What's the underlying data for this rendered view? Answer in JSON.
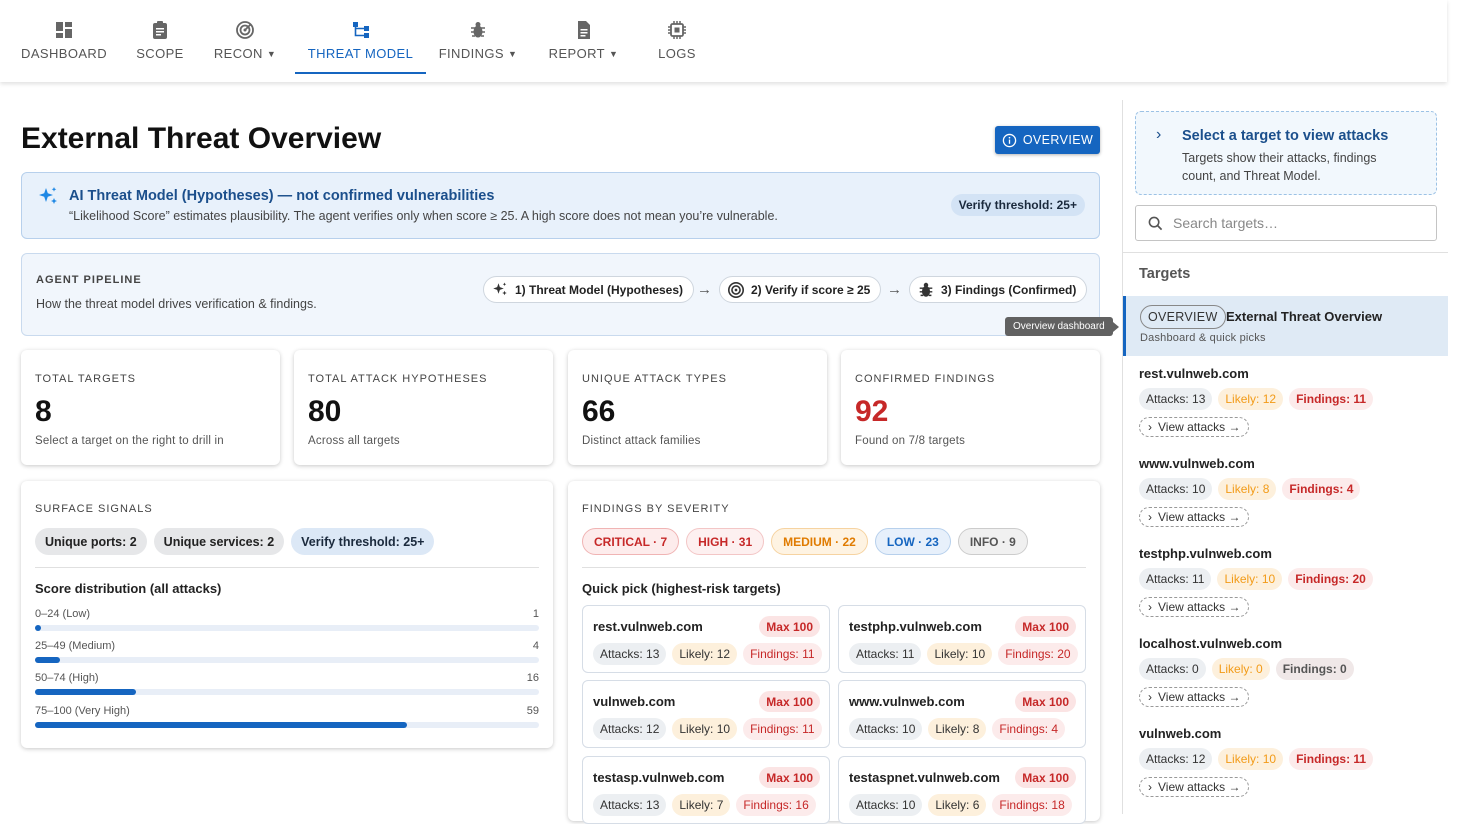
{
  "nav": {
    "items": [
      {
        "label": "DASHBOARD",
        "icon": "dashboard-icon",
        "caret": false
      },
      {
        "label": "SCOPE",
        "icon": "clipboard-icon",
        "caret": false
      },
      {
        "label": "RECON",
        "icon": "target-icon",
        "caret": true
      },
      {
        "label": "THREAT MODEL",
        "icon": "hierarchy-icon",
        "caret": false,
        "active": true
      },
      {
        "label": "FINDINGS",
        "icon": "bug-icon",
        "caret": true
      },
      {
        "label": "REPORT",
        "icon": "document-icon",
        "caret": true
      },
      {
        "label": "LOGS",
        "icon": "chip-icon",
        "caret": false
      }
    ]
  },
  "page": {
    "title": "External Threat Overview",
    "overview_button": "OVERVIEW"
  },
  "ai_notice": {
    "title": "AI Threat Model (Hypotheses) — not confirmed vulnerabilities",
    "text": "“Likelihood Score” estimates plausibility. The agent verifies only when score ≥ 25. A high score does not mean you’re vulnerable.",
    "chip": "Verify threshold: 25+"
  },
  "pipeline": {
    "title": "AGENT PIPELINE",
    "subtitle": "How the threat model drives verification & findings.",
    "steps": [
      "1) Threat Model (Hypotheses)",
      "2) Verify if score ≥ 25",
      "3) Findings (Confirmed)"
    ],
    "arrow": "→",
    "tooltip": "Overview dashboard"
  },
  "stats": [
    {
      "label": "TOTAL TARGETS",
      "value": "8",
      "hint": "Select a target on the right to drill in"
    },
    {
      "label": "TOTAL ATTACK HYPOTHESES",
      "value": "80",
      "hint": "Across all targets"
    },
    {
      "label": "UNIQUE ATTACK TYPES",
      "value": "66",
      "hint": "Distinct attack families"
    },
    {
      "label": "CONFIRMED FINDINGS",
      "value": "92",
      "hint": "Found on 7/8 targets"
    }
  ],
  "surface": {
    "title": "SURFACE SIGNALS",
    "chips": [
      "Unique ports: 2",
      "Unique services: 2",
      "Verify threshold: 25+"
    ],
    "dist_title": "Score distribution (all attacks)",
    "dist_max": 59,
    "dist": [
      {
        "label": "0–24 (Low)",
        "count": 1
      },
      {
        "label": "25–49 (Medium)",
        "count": 4
      },
      {
        "label": "50–74 (High)",
        "count": 16
      },
      {
        "label": "75–100 (Very High)",
        "count": 59
      }
    ]
  },
  "severity": {
    "title": "FINDINGS BY SEVERITY",
    "chips": [
      {
        "label": "CRITICAL · 7",
        "color": "#c62828",
        "bg": "#fdecec",
        "border": "#f0b4b4"
      },
      {
        "label": "HIGH · 31",
        "color": "#c62828",
        "bg": "#fdf0f0",
        "border": "#f3c6c6"
      },
      {
        "label": "MEDIUM · 22",
        "color": "#e07b00",
        "bg": "#fef3e2",
        "border": "#f6d3a1"
      },
      {
        "label": "LOW · 23",
        "color": "#1565c0",
        "bg": "#e7f0fb",
        "border": "#b7d0ec"
      },
      {
        "label": "INFO · 9",
        "color": "#555555",
        "bg": "#f0f0f0",
        "border": "#cccccc"
      }
    ],
    "quick_title": "Quick pick (highest-risk targets)",
    "quick": [
      {
        "name": "rest.vulnweb.com",
        "max": "Max 100",
        "attacks": "Attacks: 13",
        "likely": "Likely: 12",
        "findings": "Findings: 11"
      },
      {
        "name": "testphp.vulnweb.com",
        "max": "Max 100",
        "attacks": "Attacks: 11",
        "likely": "Likely: 10",
        "findings": "Findings: 20"
      },
      {
        "name": "vulnweb.com",
        "max": "Max 100",
        "attacks": "Attacks: 12",
        "likely": "Likely: 10",
        "findings": "Findings: 11"
      },
      {
        "name": "www.vulnweb.com",
        "max": "Max 100",
        "attacks": "Attacks: 10",
        "likely": "Likely: 8",
        "findings": "Findings: 4"
      },
      {
        "name": "testasp.vulnweb.com",
        "max": "Max 100",
        "attacks": "Attacks: 13",
        "likely": "Likely: 7",
        "findings": "Findings: 16"
      },
      {
        "name": "testaspnet.vulnweb.com",
        "max": "Max 100",
        "attacks": "Attacks: 10",
        "likely": "Likely: 6",
        "findings": "Findings: 18"
      }
    ]
  },
  "sidebar": {
    "select_title": "Select a target to view attacks",
    "select_text": "Targets show their attacks, findings count, and Threat Model.",
    "search_placeholder": "Search targets…",
    "targets_title": "Targets",
    "overview_pill": "OVERVIEW",
    "overview_name": "External Threat Overview",
    "overview_sub": "Dashboard & quick picks",
    "view_label": "View attacks →",
    "targets": [
      {
        "name": "rest.vulnweb.com",
        "attacks": "Attacks: 13",
        "likely": "Likely: 12",
        "findings": "Findings: 11",
        "zero": false
      },
      {
        "name": "www.vulnweb.com",
        "attacks": "Attacks: 10",
        "likely": "Likely: 8",
        "findings": "Findings: 4",
        "zero": false
      },
      {
        "name": "testphp.vulnweb.com",
        "attacks": "Attacks: 11",
        "likely": "Likely: 10",
        "findings": "Findings: 20",
        "zero": false
      },
      {
        "name": "localhost.vulnweb.com",
        "attacks": "Attacks: 0",
        "likely": "Likely: 0",
        "findings": "Findings: 0",
        "zero": true
      },
      {
        "name": "vulnweb.com",
        "attacks": "Attacks: 12",
        "likely": "Likely: 10",
        "findings": "Findings: 11",
        "zero": false
      }
    ]
  }
}
